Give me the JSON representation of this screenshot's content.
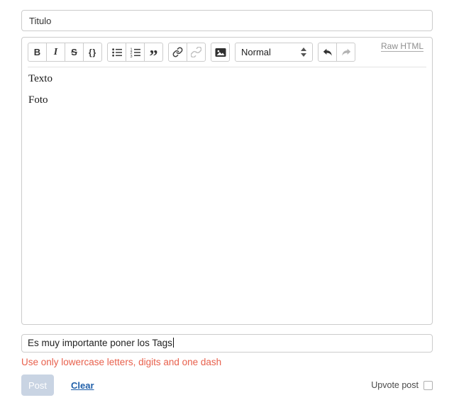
{
  "title_input": {
    "value": "Titulo"
  },
  "editor_toolbar": {
    "bold_label": "B",
    "italic_label": "I",
    "strike_label": "S",
    "code_label": "{}",
    "quote_glyph": "”",
    "format_select_value": "Normal",
    "raw_html_label": "Raw HTML",
    "icons": {
      "bulleted_list": "list-bullets-icon",
      "numbered_list": "list-numbers-icon",
      "link": "chain-link-icon",
      "unlink": "broken-chain-icon",
      "image": "image-icon",
      "undo": "undo-arrow-icon",
      "redo": "redo-arrow-icon"
    }
  },
  "editor_body": {
    "paragraphs": [
      "Texto",
      "Foto"
    ]
  },
  "tags": {
    "value": "Es muy importante poner los Tags",
    "error": "Use only lowercase letters, digits and one dash"
  },
  "footer": {
    "post_label": "Post",
    "clear_label": "Clear",
    "upvote_label": "Upvote post",
    "upvote_checked": false
  },
  "colors": {
    "border": "#cccccc",
    "error_red": "#e8604c",
    "link_blue": "#1f5fa9",
    "post_button_bg": "#c9d4e3",
    "raw_html_gray": "#8e8e8e"
  }
}
